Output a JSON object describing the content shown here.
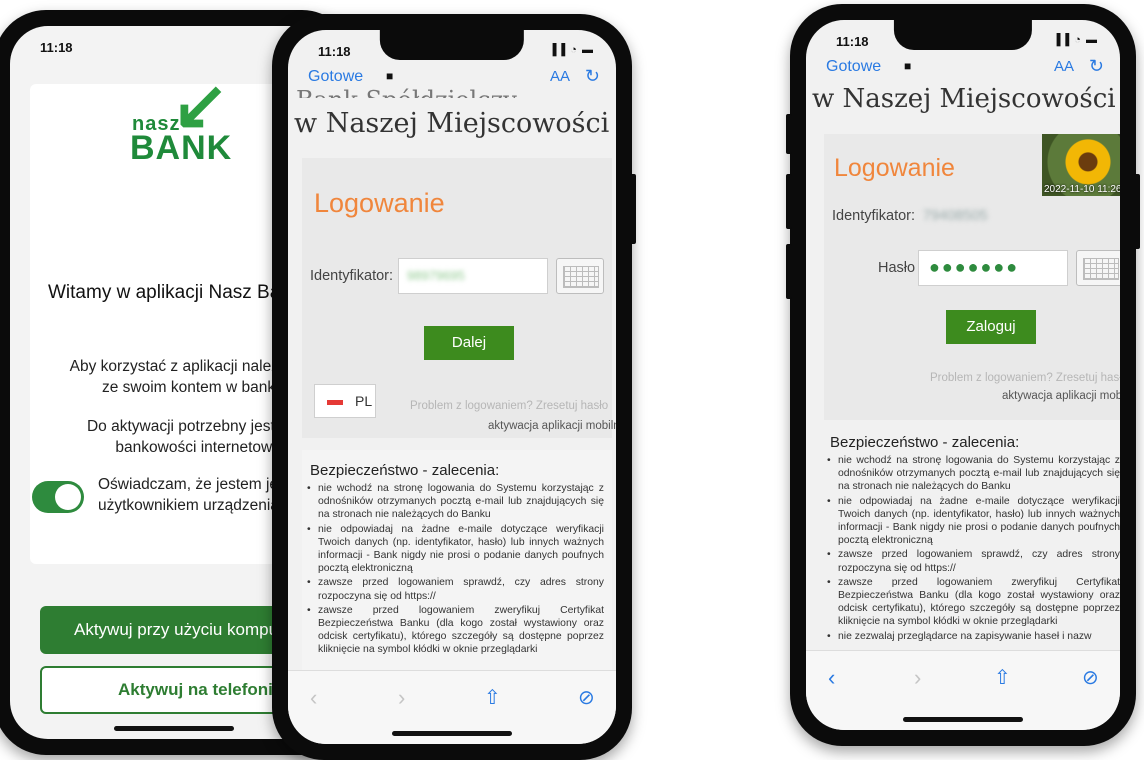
{
  "phone1": {
    "time": "11:18",
    "logo": {
      "line1": "nasz",
      "line2": "BANK"
    },
    "welcome": "Witamy w aplikacji Nasz Ba",
    "para1_line1": "Aby korzystać z aplikacji należy poła",
    "para1_line2": "ze swoim kontem w banku.",
    "para2_line1": "Do aktywacji potrzebny jest doste",
    "para2_line2": "bankowości internetowej.",
    "toggle_line1": "Oświadczam, że jestem jed",
    "toggle_line2": "użytkownikiem urządzenia",
    "btn_primary": "Aktywuj przy użyciu komput",
    "btn_outline": "Aktywuj na telefonie"
  },
  "phone2": {
    "time": "11:18",
    "nav_done": "Gotowe",
    "nav_aa": "AA",
    "bank_title_top": "Bank Spółdzielczy",
    "bank_title": "w Naszej Miejscowości",
    "login_heading": "Logowanie",
    "id_label": "Identyfikator:",
    "id_value": "98979695",
    "next_button": "Dalej",
    "lang": "PL",
    "problem_link": "Problem z logowaniem? Zresetuj hasło",
    "activation_link": "aktywacja aplikacji mobilnej",
    "security_title": "Bezpieczeństwo - zalecenia:",
    "security_items": [
      "nie wchodź na stronę logowania do Systemu korzystając z odnośników otrzymanych pocztą e-mail lub znajdujących się na stronach nie należących do Banku",
      "nie odpowiadaj na żadne e-maile dotyczące weryfikacji Twoich danych (np. identyfikator, hasło) lub innych ważnych informacji - Bank nigdy nie prosi o podanie danych poufnych pocztą elektroniczną",
      "zawsze przed logowaniem sprawdź, czy adres strony rozpoczyna się od https://",
      "zawsze przed logowaniem zweryfikuj Certyfikat Bezpieczeństwa Banku (dla kogo został wystawiony oraz odcisk certyfikatu), którego szczegóły są dostępne poprzez kliknięcie na symbol kłódki w oknie przeglądarki"
    ]
  },
  "phone3": {
    "time": "11:18",
    "nav_done": "Gotowe",
    "nav_aa": "AA",
    "bank_title": "w Naszej Miejscowości",
    "login_heading": "Logowanie",
    "photo_timestamp": "2022-11-10 11:26",
    "id_label": "Identyfikator:",
    "id_value": "79408505",
    "password_label": "Hasło",
    "password_value": "●●●●●●●",
    "login_button": "Zaloguj",
    "problem_link": "Problem z logowaniem? Zresetuj hasło",
    "activation_link": "aktywacja aplikacji mobilnej",
    "security_title": "Bezpieczeństwo - zalecenia:",
    "security_items": [
      "nie wchodź na stronę logowania do Systemu korzystając z odnośników otrzymanych pocztą e-mail lub znajdujących się na stronach nie należących do Banku",
      "nie odpowiadaj na żadne e-maile dotyczące weryfikacji Twoich danych (np. identyfikator, hasło) lub innych ważnych informacji - Bank nigdy nie prosi o podanie danych poufnych pocztą elektroniczną",
      "zawsze przed logowaniem sprawdź, czy adres strony rozpoczyna się od https://",
      "zawsze przed logowaniem zweryfikuj Certyfikat Bezpieczeństwa Banku (dla kogo został wystawiony oraz odcisk certyfikatu), którego szczegóły są dostępne poprzez kliknięcie na symbol kłódki w oknie przeglądarki",
      "nie zezwalaj przeglądarce na zapisywanie haseł i nazw"
    ]
  },
  "icons": {
    "signal": "signal-icon",
    "wifi": "wifi-icon",
    "battery": "battery-icon",
    "lock": "lock-icon",
    "reload": "reload-icon",
    "back": "back-icon",
    "forward": "forward-icon",
    "share": "share-icon",
    "compass": "compass-icon",
    "keyboard": "keyboard-icon"
  },
  "colors": {
    "brand_green": "#2e7d32",
    "login_orange": "#f0863c",
    "link_blue": "#2a7ae2",
    "button_green": "#3d8b1e"
  }
}
